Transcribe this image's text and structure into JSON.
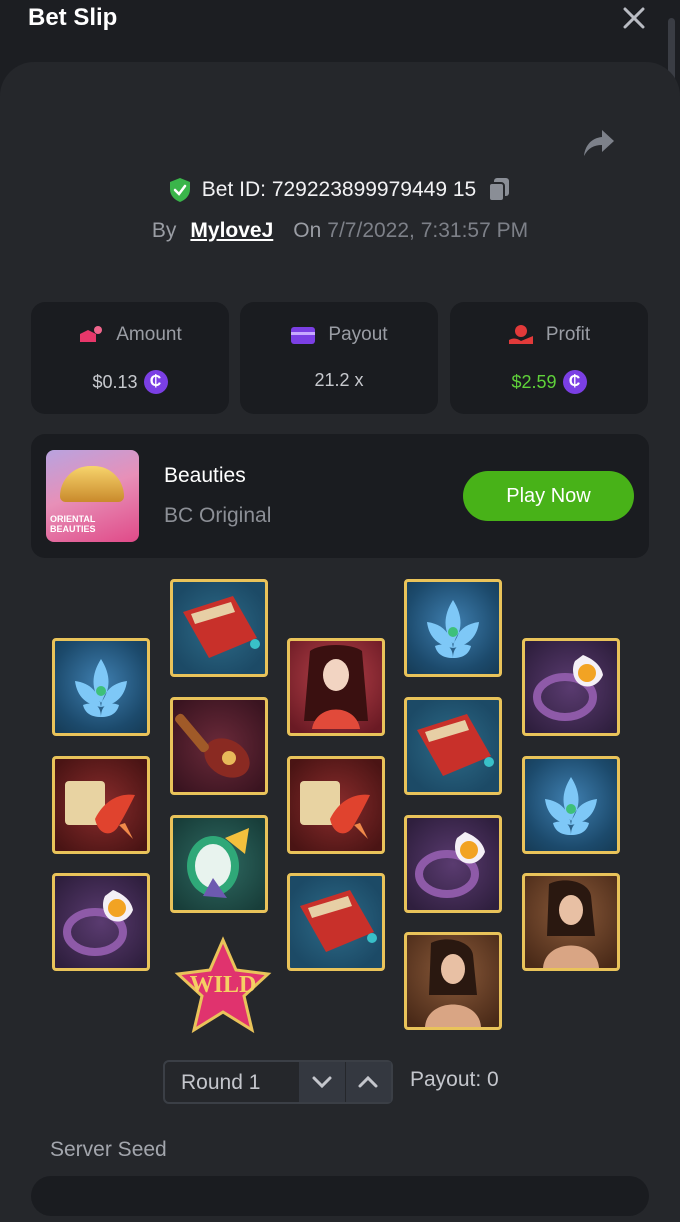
{
  "header": {
    "title": "Bet Slip",
    "close_icon": "close-icon"
  },
  "bet": {
    "id_label": "Bet ID: 729223899979449 15",
    "by_label": "By",
    "username": "MyloveJ",
    "on_label": "On",
    "datetime": "7/7/2022, 7:31:57 PM"
  },
  "stats": {
    "amount": {
      "label": "Amount",
      "value": "$0.13"
    },
    "payout": {
      "label": "Payout",
      "value": "21.2 x"
    },
    "profit": {
      "label": "Profit",
      "value": "$2.59"
    },
    "coin_symbol": "₵"
  },
  "game": {
    "thumb_text": "ORIENTAL BEAUTIES",
    "name": "Beauties",
    "provider": "BC Original",
    "play_label": "Play Now"
  },
  "reels": {
    "wild_label": "WILD",
    "columns": [
      [
        "lotus",
        "fish",
        "ring"
      ],
      [
        "book",
        "pipa",
        "fan",
        "wild"
      ],
      [
        "lady-red",
        "fish",
        "book"
      ],
      [
        "lotus",
        "book",
        "ring",
        "lady-brown"
      ],
      [
        "ring",
        "lotus",
        "lady-brown"
      ]
    ]
  },
  "round": {
    "label": "Round 1",
    "payout_text": "Payout: 0"
  },
  "seed": {
    "label": "Server Seed"
  },
  "colors": {
    "accent_green": "#48b218",
    "profit_green": "#5fd13a",
    "coin_purple": "#7b3fe4",
    "tile_border": "#e9c35a"
  }
}
